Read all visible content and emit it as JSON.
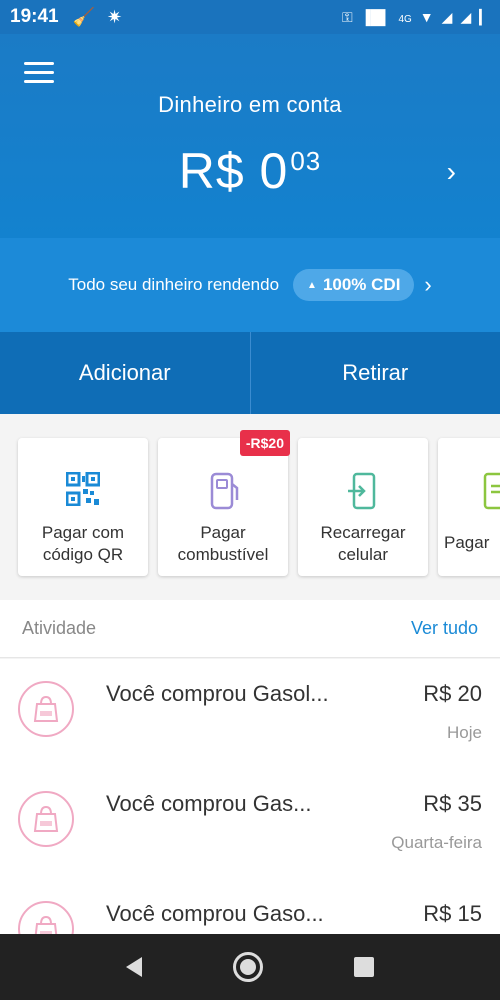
{
  "status_bar": {
    "time": "19:41",
    "icons_left": [
      "broom-icon",
      "bug-icon"
    ],
    "icons_right": [
      "key-icon",
      "vibrate-icon",
      "call-4g-icon",
      "wifi-icon",
      "signal-icon",
      "signal-icon",
      "battery-icon"
    ],
    "network": "4G"
  },
  "header": {
    "balance_label": "Dinheiro em conta",
    "balance_main": "R$ 0",
    "balance_cents": "03"
  },
  "yield": {
    "text": "Todo seu dinheiro rendendo",
    "pill": "100% CDI"
  },
  "actions": {
    "add_label": "Adicionar",
    "withdraw_label": "Retirar"
  },
  "shortcuts": [
    {
      "label": "Pagar com\ncódigo QR",
      "icon": "qr-code-icon"
    },
    {
      "label": "Pagar\ncombustível",
      "icon": "fuel-icon",
      "badge": "-R$20"
    },
    {
      "label": "Recarregar\ncelular",
      "icon": "phone-recharge-icon"
    },
    {
      "label": "Pagar",
      "icon": "bill-icon"
    }
  ],
  "activity": {
    "title": "Atividade",
    "see_all": "Ver tudo",
    "items": [
      {
        "desc": "Você comprou Gasol...",
        "amount": "R$ 20",
        "date": "Hoje"
      },
      {
        "desc": "Você comprou Gas...",
        "amount": "R$ 35",
        "date": "Quarta-feira"
      },
      {
        "desc": "Você comprou Gaso...",
        "amount": "R$ 15",
        "date": ""
      }
    ]
  },
  "colors": {
    "primary": "#1382cf",
    "accent_pink": "#f0a9c3",
    "badge_red": "#e8304a",
    "link_blue": "#1a8ad6"
  }
}
